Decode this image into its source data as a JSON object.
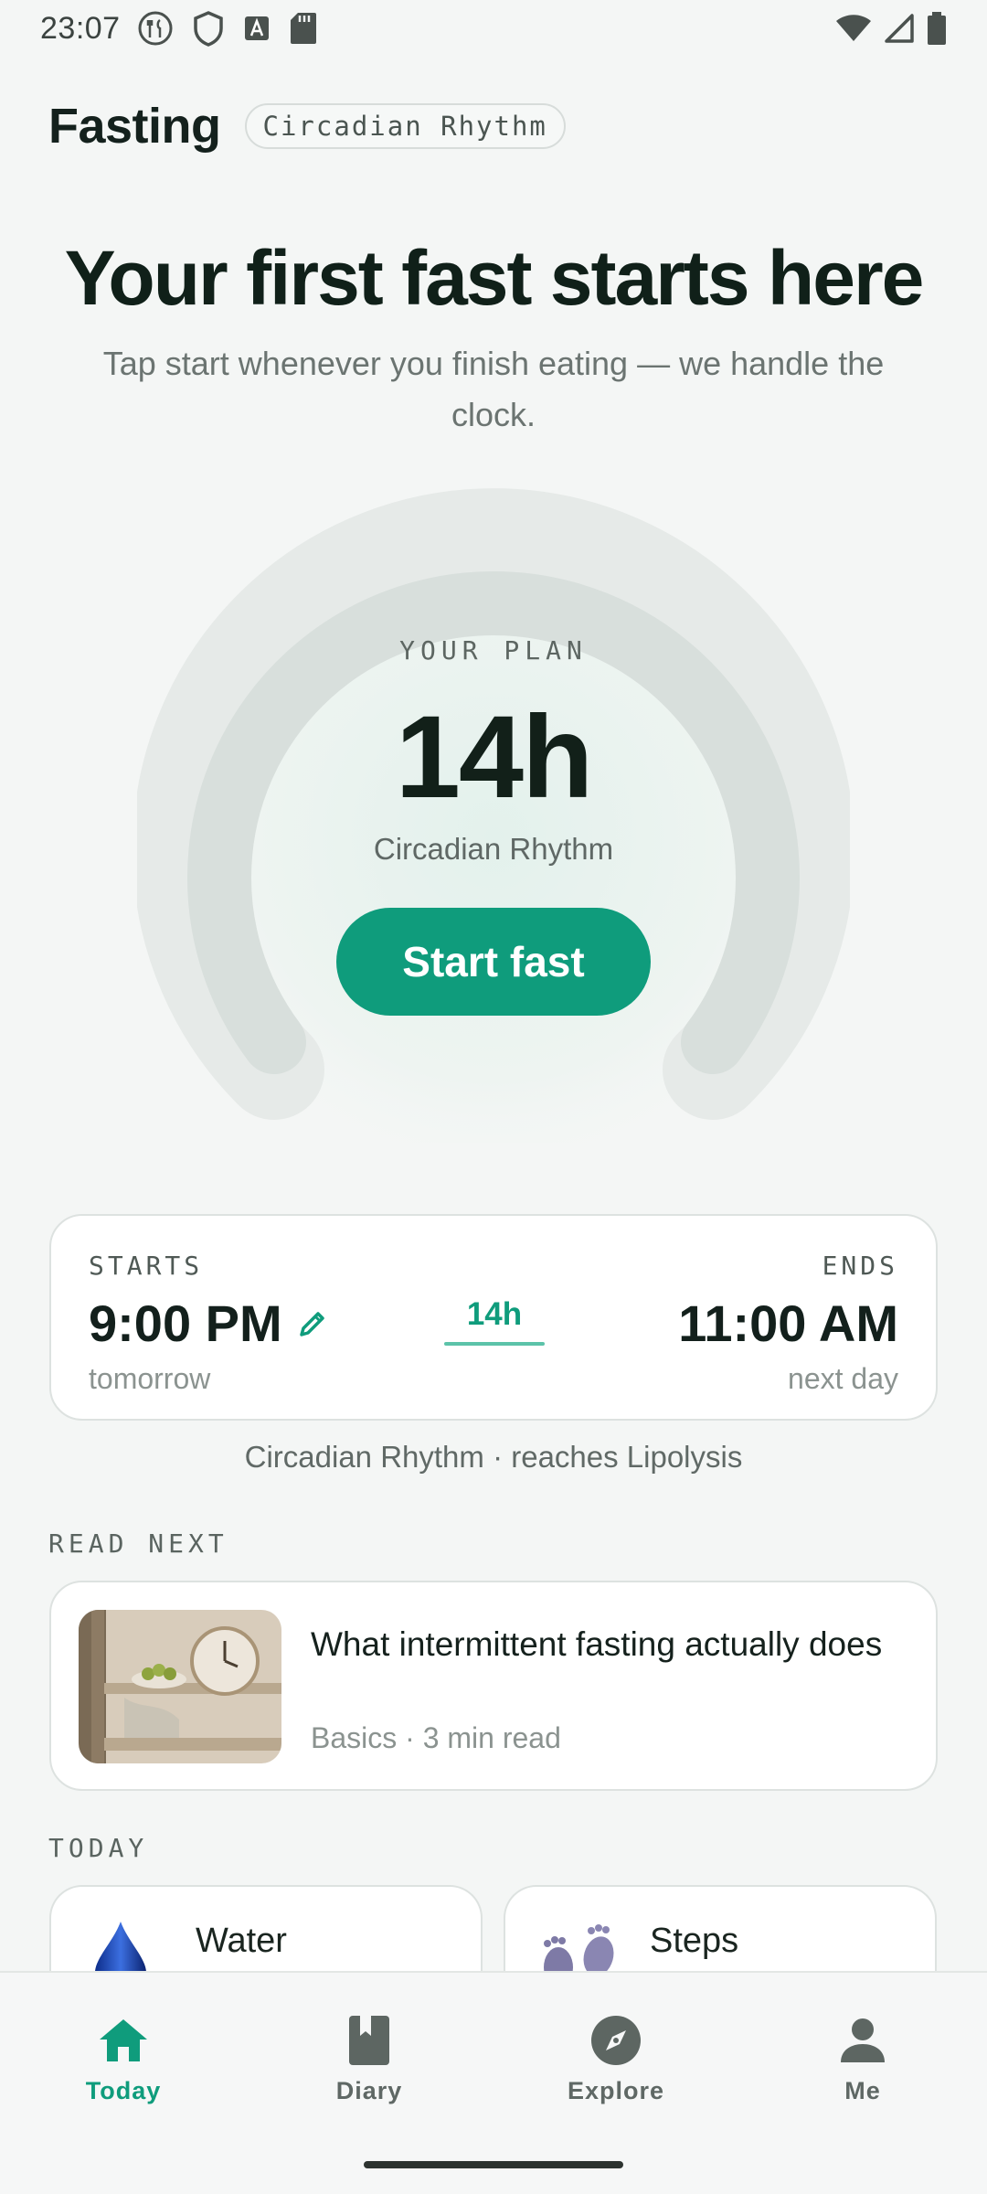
{
  "status_bar": {
    "time": "23:07"
  },
  "header": {
    "title": "Fasting",
    "plan_chip": "Circadian Rhythm"
  },
  "hero": {
    "title": "Your first fast starts here",
    "subtitle": "Tap start whenever you finish eating — we handle the clock."
  },
  "dial": {
    "label": "YOUR PLAN",
    "hours": "14h",
    "plan_name": "Circadian Rhythm",
    "start_button": "Start fast"
  },
  "schedule": {
    "start_label": "STARTS",
    "start_time": "9:00 PM",
    "start_day": "tomorrow",
    "duration": "14h",
    "end_label": "ENDS",
    "end_time": "11:00 AM",
    "end_day": "next day",
    "phase_note": "Circadian Rhythm · reaches Lipolysis"
  },
  "read_next": {
    "section_label": "READ NEXT",
    "article_title": "What intermittent fasting actually does",
    "article_meta": "Basics · 3 min read"
  },
  "today": {
    "section_label": "TODAY",
    "cards": [
      {
        "label": "Water",
        "icon": "water-drop-icon"
      },
      {
        "label": "Steps",
        "icon": "footprints-icon"
      }
    ]
  },
  "bottom_nav": {
    "items": [
      {
        "label": "Today",
        "icon": "home-icon",
        "active": true
      },
      {
        "label": "Diary",
        "icon": "book-icon",
        "active": false
      },
      {
        "label": "Explore",
        "icon": "compass-icon",
        "active": false
      },
      {
        "label": "Me",
        "icon": "person-icon",
        "active": false
      }
    ]
  },
  "colors": {
    "accent": "#0f9c7c",
    "background": "#f4f6f5",
    "text_primary": "#13201c",
    "text_muted": "#8b9390"
  }
}
